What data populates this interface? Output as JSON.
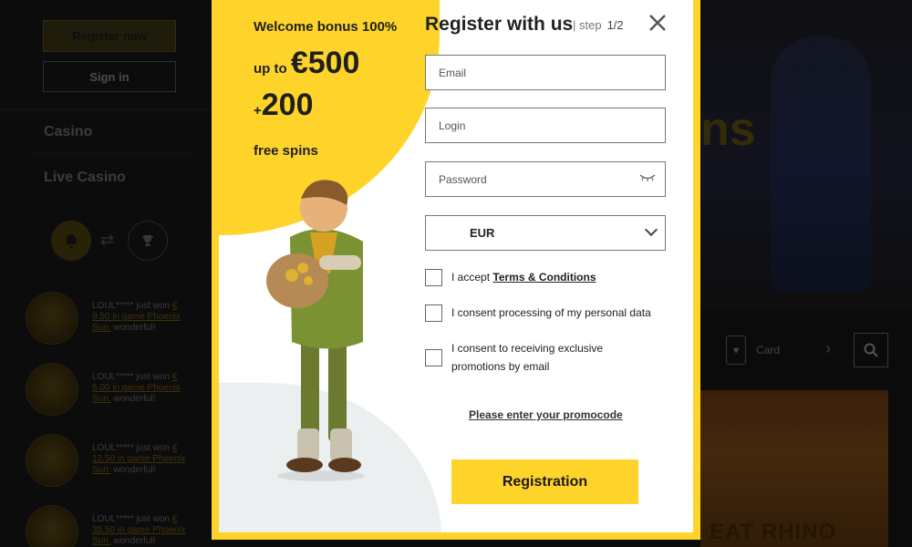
{
  "sidebar": {
    "register_label": "Register now",
    "signin_label": "Sign in",
    "nav": [
      "Casino",
      "Live Casino"
    ],
    "wins": [
      {
        "user": "LOUL***** just won",
        "amount": "€ 9.50 in game Phoenix Sun.",
        "suffix": "wonderful!"
      },
      {
        "user": "LOUL***** just won",
        "amount": "€ 5.00 in game Phoenix Sun.",
        "suffix": "wonderful!"
      },
      {
        "user": "LOUL***** just won",
        "amount": "€ 12.50 in game Phoenix Sun.",
        "suffix": "wonderful!"
      },
      {
        "user": "LOUL***** just won",
        "amount": "€ 35.50 in game Phoenix Sun.",
        "suffix": "wonderful!"
      }
    ]
  },
  "background": {
    "banner_text": "ns",
    "category_label": "Card",
    "game_tile_text": "EAT RHINO"
  },
  "promo": {
    "line1": "Welcome bonus 100%",
    "up_to": "up to",
    "amount": "€500",
    "plus": "+",
    "spins": "200",
    "free_spins": "free spins"
  },
  "register": {
    "title": "Register with us",
    "step_label": "| step",
    "step_value": "1/2",
    "email_placeholder": "Email",
    "login_placeholder": "Login",
    "password_placeholder": "Password",
    "currency": "EUR",
    "accept_prefix": "I accept",
    "terms_link": "Terms & Conditions",
    "consent_data": "I consent processing of my personal data",
    "consent_promo": "I consent to receiving exclusive promotions by email",
    "promocode_link": "Please enter your promocode",
    "submit_label": "Registration"
  },
  "colors": {
    "accent": "#ffd42a",
    "background": "#141414"
  }
}
